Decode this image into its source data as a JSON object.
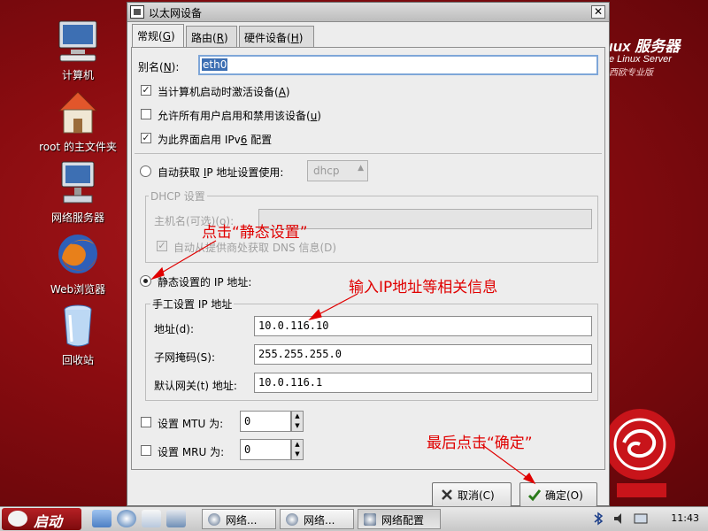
{
  "desktop": {
    "icons": [
      {
        "label": "计算机"
      },
      {
        "label": "root 的主文件夹"
      },
      {
        "label": "网络服务器"
      },
      {
        "label": "Web浏览器"
      },
      {
        "label": "回收站"
      }
    ],
    "brand": {
      "big": "ıux 服务器",
      "mid": "e Linux Server",
      "small": "西欧专业版"
    }
  },
  "dialog": {
    "title": "以太网设备",
    "tabs": [
      {
        "label": "常规(",
        "key": "G",
        "tail": ")"
      },
      {
        "label": "路由(",
        "key": "R",
        "tail": ")"
      },
      {
        "label": "硬件设备(",
        "key": "H",
        "tail": ")"
      }
    ],
    "alias": {
      "label": "别名(",
      "key": "N",
      "tail": "):",
      "value": "eth0"
    },
    "opt_boot": {
      "label": "当计算机启动时激活设备(",
      "key": "A",
      "tail": ")",
      "checked": true
    },
    "opt_users": {
      "label": "允许所有用户启用和禁用该设备(",
      "key": "u",
      "tail": ")",
      "checked": false
    },
    "opt_ipv6": {
      "label": "为此界面启用  IPv",
      "key": "6",
      "tail": " 配置",
      "checked": true
    },
    "auto_ip": {
      "label": "自动获取  ",
      "key": "I",
      "tail": "P 地址设置使用:",
      "combo_value": "dhcp"
    },
    "dhcp": {
      "frame_title": "DHCP 设置",
      "hostname_label": "主机名(可选)(o):",
      "auto_dns_label": "自动从提供商处获取  DNS 信息(D)"
    },
    "static": {
      "label": "静态设置的  IP 地址:",
      "frame_title": "手工设置  IP 地址",
      "address_label": "地址(d):",
      "address_value": "10.0.116.10",
      "netmask_label": "子网掩码(S):",
      "netmask_value": "255.255.255.0",
      "gateway_label": "默认网关(t) 地址:",
      "gateway_value": "10.0.116.1"
    },
    "mtu": {
      "label": "设置  MTU 为:",
      "value": "0"
    },
    "mru": {
      "label": "设置  MRU 为:",
      "value": "0"
    },
    "cancel_label": "取消(C)",
    "ok_label": "确定(O)"
  },
  "annotations": {
    "click_static": "点击“静态设置”",
    "enter_ip": "输入IP地址等相关信息",
    "click_ok": "最后点击“确定”",
    "color": "#e00000"
  },
  "taskbar": {
    "start_label": "启动",
    "tasks": [
      {
        "label": "网络..."
      },
      {
        "label": "网络..."
      },
      {
        "label": "网络配置"
      }
    ],
    "clock": "11:43"
  }
}
